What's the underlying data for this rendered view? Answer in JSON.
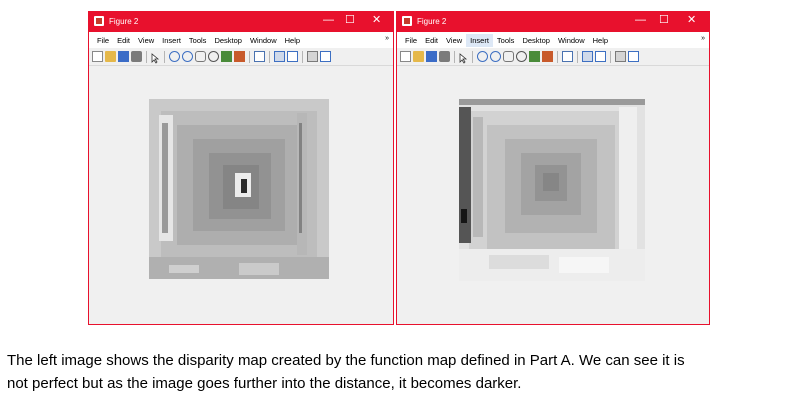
{
  "left_window": {
    "title": "Figure 2",
    "controls": {
      "minimize": "—",
      "maximize": "☐",
      "close": "✕"
    },
    "menu": [
      "File",
      "Edit",
      "View",
      "Insert",
      "Tools",
      "Desktop",
      "Window",
      "Help"
    ],
    "menu_active": ""
  },
  "right_window": {
    "title": "Figure 2",
    "controls": {
      "minimize": "—",
      "maximize": "☐",
      "close": "✕"
    },
    "menu": [
      "File",
      "Edit",
      "View",
      "Insert",
      "Tools",
      "Desktop",
      "Window",
      "Help"
    ],
    "menu_active": "Insert"
  },
  "toolbar_icons": [
    "new-figure-icon",
    "open-file-icon",
    "save-icon",
    "print-icon",
    "pointer-icon",
    "zoom-in-icon",
    "zoom-out-icon",
    "pan-icon",
    "rotate-3d-icon",
    "data-cursor-icon",
    "brush-icon",
    "link-plot-icon",
    "colorbar-icon",
    "legend-icon",
    "hide-plot-tools-icon",
    "show-plot-tools-icon"
  ],
  "caption": {
    "line1": "The left image shows the disparity map created by the function map defined in Part A. We can see it is",
    "line2": "not perfect but as the image goes further into the distance, it becomes darker."
  }
}
